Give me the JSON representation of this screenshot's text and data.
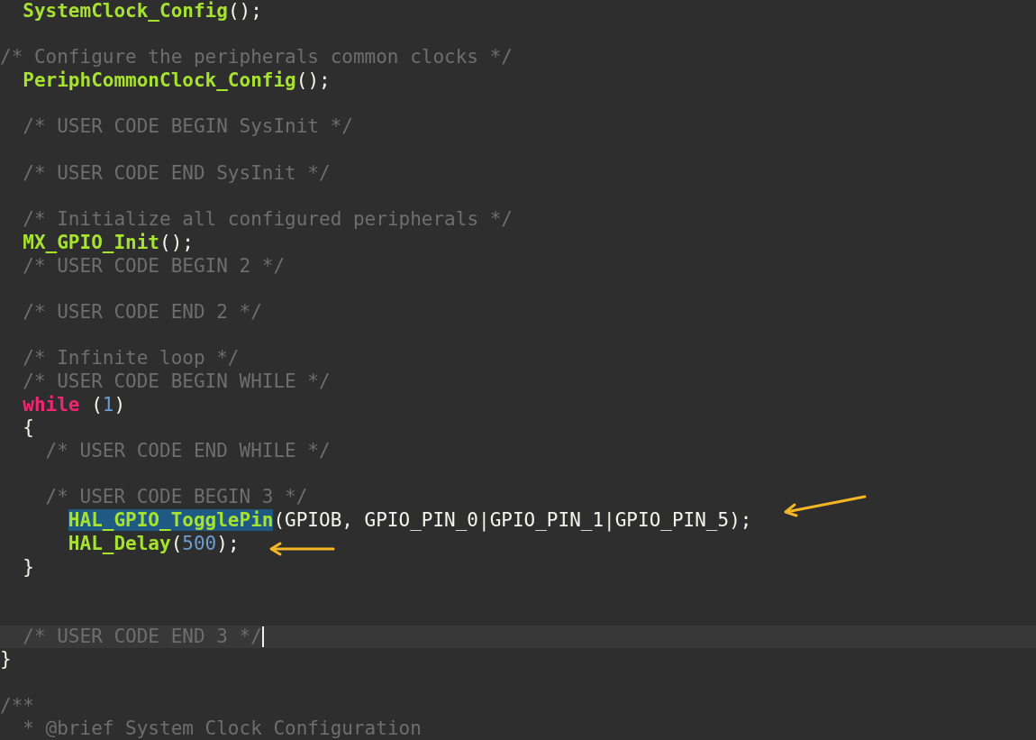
{
  "editor": {
    "lines": [
      {
        "kind": "code",
        "tokens": [
          {
            "kind": "func",
            "text": "  SystemClock_Config"
          },
          {
            "kind": "plain",
            "text": "();"
          }
        ]
      },
      {
        "kind": "blank"
      },
      {
        "kind": "code",
        "tokens": [
          {
            "kind": "comment",
            "text": "/* Configure the peripherals common clocks */"
          }
        ]
      },
      {
        "kind": "code",
        "tokens": [
          {
            "kind": "func",
            "text": "  PeriphCommonClock_Config"
          },
          {
            "kind": "plain",
            "text": "();"
          }
        ]
      },
      {
        "kind": "blank"
      },
      {
        "kind": "code",
        "tokens": [
          {
            "kind": "comment",
            "text": "  /* USER CODE BEGIN SysInit */"
          }
        ]
      },
      {
        "kind": "blank"
      },
      {
        "kind": "code",
        "tokens": [
          {
            "kind": "comment",
            "text": "  /* USER CODE END SysInit */"
          }
        ]
      },
      {
        "kind": "blank"
      },
      {
        "kind": "code",
        "tokens": [
          {
            "kind": "comment",
            "text": "  /* Initialize all configured peripherals */"
          }
        ]
      },
      {
        "kind": "code",
        "tokens": [
          {
            "kind": "func",
            "text": "  MX_GPIO_Init"
          },
          {
            "kind": "plain",
            "text": "();"
          }
        ]
      },
      {
        "kind": "code",
        "tokens": [
          {
            "kind": "comment",
            "text": "  /* USER CODE BEGIN 2 */"
          }
        ]
      },
      {
        "kind": "blank"
      },
      {
        "kind": "code",
        "tokens": [
          {
            "kind": "comment",
            "text": "  /* USER CODE END 2 */"
          }
        ]
      },
      {
        "kind": "blank"
      },
      {
        "kind": "code",
        "tokens": [
          {
            "kind": "comment",
            "text": "  /* Infinite loop */"
          }
        ]
      },
      {
        "kind": "code",
        "tokens": [
          {
            "kind": "comment",
            "text": "  /* USER CODE BEGIN WHILE */"
          }
        ]
      },
      {
        "kind": "code",
        "tokens": [
          {
            "kind": "keyword",
            "text": "  while"
          },
          {
            "kind": "plain",
            "text": " ("
          },
          {
            "kind": "number",
            "text": "1"
          },
          {
            "kind": "plain",
            "text": ")"
          }
        ]
      },
      {
        "kind": "code",
        "tokens": [
          {
            "kind": "plain",
            "text": "  {"
          }
        ]
      },
      {
        "kind": "code",
        "tokens": [
          {
            "kind": "comment",
            "text": "    /* USER CODE END WHILE */"
          }
        ]
      },
      {
        "kind": "blank"
      },
      {
        "kind": "code",
        "tokens": [
          {
            "kind": "comment",
            "text": "    /* USER CODE BEGIN 3 */"
          }
        ]
      },
      {
        "kind": "code",
        "tokens": [
          {
            "kind": "match",
            "text": "      HAL_GPIO_TogglePin"
          },
          {
            "kind": "plain",
            "text": "(GPIOB, GPIO_PIN_0|GPIO_PIN_1|GPIO_PIN_5);"
          }
        ]
      },
      {
        "kind": "code",
        "tokens": [
          {
            "kind": "func",
            "text": "      HAL_Delay"
          },
          {
            "kind": "plain",
            "text": "("
          },
          {
            "kind": "number",
            "text": "500"
          },
          {
            "kind": "plain",
            "text": ");"
          }
        ]
      },
      {
        "kind": "code",
        "tokens": [
          {
            "kind": "plain",
            "text": "  }"
          }
        ]
      },
      {
        "kind": "blank"
      },
      {
        "kind": "blank"
      },
      {
        "kind": "current",
        "tokens": [
          {
            "kind": "comment",
            "text": "  /* USER CODE END 3 */"
          }
        ]
      },
      {
        "kind": "code",
        "tokens": [
          {
            "kind": "plain",
            "text": "}"
          }
        ]
      },
      {
        "kind": "blank"
      },
      {
        "kind": "code",
        "tokens": [
          {
            "kind": "comment",
            "text": "/**"
          }
        ]
      },
      {
        "kind": "code",
        "tokens": [
          {
            "kind": "comment",
            "text": "  * @brief System Clock Configuration"
          }
        ]
      }
    ]
  }
}
